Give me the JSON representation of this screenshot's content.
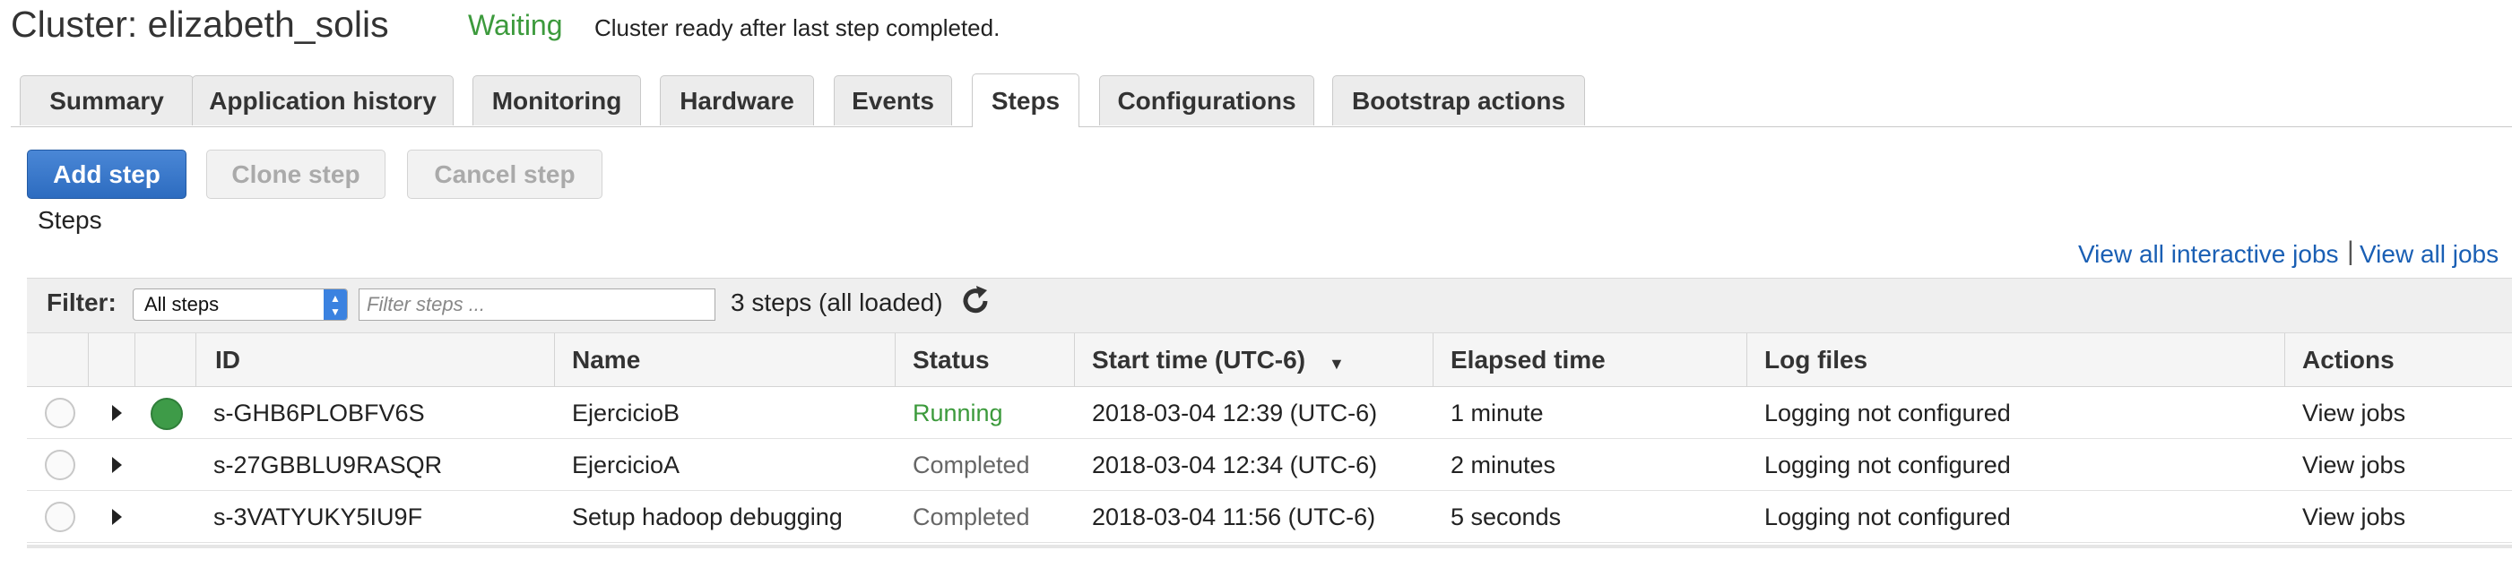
{
  "header": {
    "title": "Cluster: elizabeth_solis",
    "status": "Waiting",
    "status_message": "Cluster ready after last step completed."
  },
  "tabs": [
    {
      "label": "Summary"
    },
    {
      "label": "Application history"
    },
    {
      "label": "Monitoring"
    },
    {
      "label": "Hardware"
    },
    {
      "label": "Events"
    },
    {
      "label": "Steps",
      "active": true
    },
    {
      "label": "Configurations"
    },
    {
      "label": "Bootstrap actions"
    }
  ],
  "toolbar": {
    "add_step": "Add step",
    "clone_step": "Clone step",
    "cancel_step": "Cancel step"
  },
  "section_label": "Steps",
  "links": {
    "view_interactive": "View all interactive jobs",
    "separator": "|",
    "view_all": "View all jobs"
  },
  "filter": {
    "label": "Filter:",
    "select_value": "All steps",
    "placeholder": "Filter steps ...",
    "count": "3 steps (all loaded)"
  },
  "table": {
    "columns": [
      "ID",
      "Name",
      "Status",
      "Start time (UTC-6)",
      "Elapsed time",
      "Log files",
      "Actions"
    ],
    "rows": [
      {
        "id": "s-GHB6PLOBFV6S",
        "name": "EjercicioB",
        "status": "Running",
        "start": "2018-03-04 12:39 (UTC-6)",
        "elapsed": "1 minute",
        "logs": "Logging not configured",
        "action": "View jobs",
        "dot": true
      },
      {
        "id": "s-27GBBLU9RASQR",
        "name": "EjercicioA",
        "status": "Completed",
        "start": "2018-03-04 12:34 (UTC-6)",
        "elapsed": "2 minutes",
        "logs": "Logging not configured",
        "action": "View jobs",
        "dot": false
      },
      {
        "id": "s-3VATYUKY5IU9F",
        "name": "Setup hadoop debugging",
        "status": "Completed",
        "start": "2018-03-04 11:56 (UTC-6)",
        "elapsed": "5 seconds",
        "logs": "Logging not configured",
        "action": "View jobs",
        "dot": false
      }
    ]
  },
  "colors": {
    "accent": "#2d6cc0",
    "running": "#3c9a3c",
    "status_dot": "#3e9b48",
    "link": "#1a5fb4"
  },
  "icons": {
    "refresh": "refresh-icon",
    "sort": "sort-desc-icon",
    "expand": "expand-caret-icon",
    "select": "select-arrows-icon"
  }
}
